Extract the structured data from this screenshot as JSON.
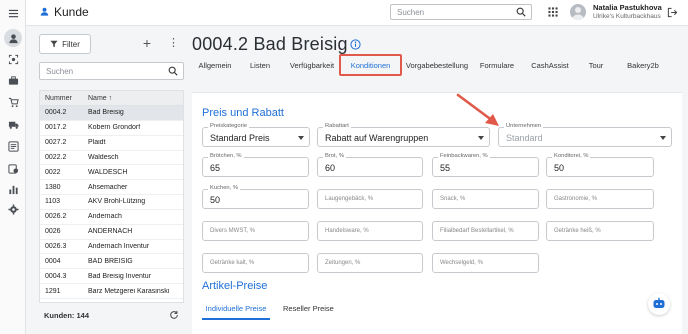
{
  "app": {
    "page_title": "Kunde"
  },
  "search": {
    "placeholder": "Suchen"
  },
  "user": {
    "name": "Natalia Pastukhova",
    "org": "Ulrike's Kulturbackhaus"
  },
  "list": {
    "filter_label": "Filter",
    "search_placeholder": "Suchen",
    "columns": [
      "Nummer",
      "Name ↑"
    ],
    "rows": [
      [
        "0004.2",
        "Bad Breisig"
      ],
      [
        "0017.2",
        "Kobern Grondorf"
      ],
      [
        "0027.2",
        "Plaidt"
      ],
      [
        "0022.2",
        "Waldesch"
      ],
      [
        "0022",
        "WALDESCH"
      ],
      [
        "1380",
        "Ahsemacher"
      ],
      [
        "1103",
        "AKV Brohl-Lützing"
      ],
      [
        "0026.2",
        "Andernach"
      ],
      [
        "0026",
        "ANDERNACH"
      ],
      [
        "0026.3",
        "Andernach Inventur"
      ],
      [
        "0004",
        "BAD BREISIG"
      ],
      [
        "0004.3",
        "Bad Breisig Inventur"
      ],
      [
        "1291",
        "Barz Metzgerei Karasinski"
      ]
    ],
    "selected_index": 0,
    "count_label": "Kunden: 144"
  },
  "detail": {
    "title": "0004.2 Bad Breisig",
    "tabs": [
      "Allgemein",
      "Listen",
      "Verfügbarkeit",
      "Konditionen",
      "Vorgabebestellung",
      "Formulare",
      "CashAssist",
      "Tour",
      "Bakery2b"
    ],
    "active_tab": "Konditionen",
    "section1_title": "Preis und Rabatt",
    "dropdowns": [
      {
        "label": "Preiskategorie",
        "value": "Standard Preis"
      },
      {
        "label": "Rabattart",
        "value": "Rabatt auf Warengruppen"
      },
      {
        "label": "Unternehmen",
        "placeholder": "Standard"
      }
    ],
    "discount_fields": [
      {
        "label": "Brötchen, %",
        "value": "65"
      },
      {
        "label": "Brot, %",
        "value": "60"
      },
      {
        "label": "Feinbackwaren, %",
        "value": "55"
      },
      {
        "label": "Konditorei, %",
        "value": "50"
      },
      {
        "label": "Kuchen, %",
        "value": "50"
      },
      {
        "label": "Laugengebäck, %",
        "value": ""
      },
      {
        "label": "Snack, %",
        "value": ""
      },
      {
        "label": "Gastronomie, %",
        "value": ""
      },
      {
        "label": "Divers MWST, %",
        "value": ""
      },
      {
        "label": "Handelsware, %",
        "value": ""
      },
      {
        "label": "Filialbedarf Bestellartikel, %",
        "value": ""
      },
      {
        "label": "Getränke heiß, %",
        "value": ""
      },
      {
        "label": "Getränke kalt, %",
        "value": ""
      },
      {
        "label": "Zeitungen, %",
        "value": ""
      },
      {
        "label": "Wechselgeld, %",
        "value": ""
      }
    ],
    "section2_title": "Artikel-Preise",
    "subtabs": [
      "Individuelle Preise",
      "Reseller Preise"
    ]
  },
  "colors": {
    "accent": "#1f6fd6",
    "highlight": "#e0594a"
  }
}
